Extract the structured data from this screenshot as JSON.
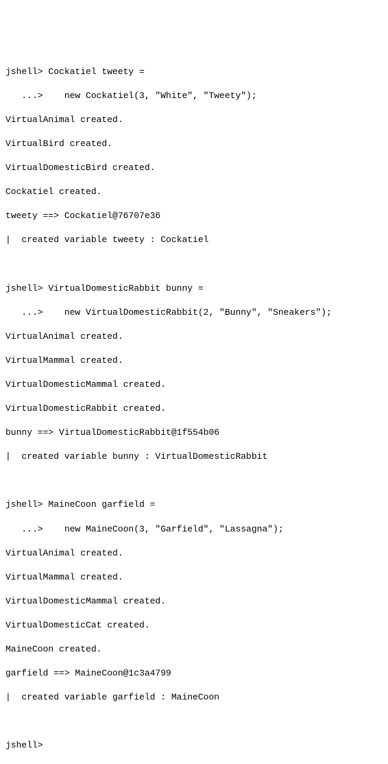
{
  "lines": [
    "jshell> Cockatiel tweety =",
    "   ...>    new Cockatiel(3, \"White\", \"Tweety\");",
    "VirtualAnimal created.",
    "VirtualBird created.",
    "VirtualDomesticBird created.",
    "Cockatiel created.",
    "tweety ==> Cockatiel@76707e36",
    "|  created variable tweety : Cockatiel",
    "",
    "jshell> VirtualDomesticRabbit bunny =",
    "   ...>    new VirtualDomesticRabbit(2, \"Bunny\", \"Sneakers\");",
    "VirtualAnimal created.",
    "VirtualMammal created.",
    "VirtualDomesticMammal created.",
    "VirtualDomesticRabbit created.",
    "bunny ==> VirtualDomesticRabbit@1f554b06",
    "|  created variable bunny : VirtualDomesticRabbit",
    "",
    "jshell> MaineCoon garfield =",
    "   ...>    new MaineCoon(3, \"Garfield\", \"Lassagna\");",
    "VirtualAnimal created.",
    "VirtualMammal created.",
    "VirtualDomesticMammal created.",
    "VirtualDomesticCat created.",
    "MaineCoon created.",
    "garfield ==> MaineCoon@1c3a4799",
    "|  created variable garfield : MaineCoon",
    "",
    "jshell>"
  ]
}
